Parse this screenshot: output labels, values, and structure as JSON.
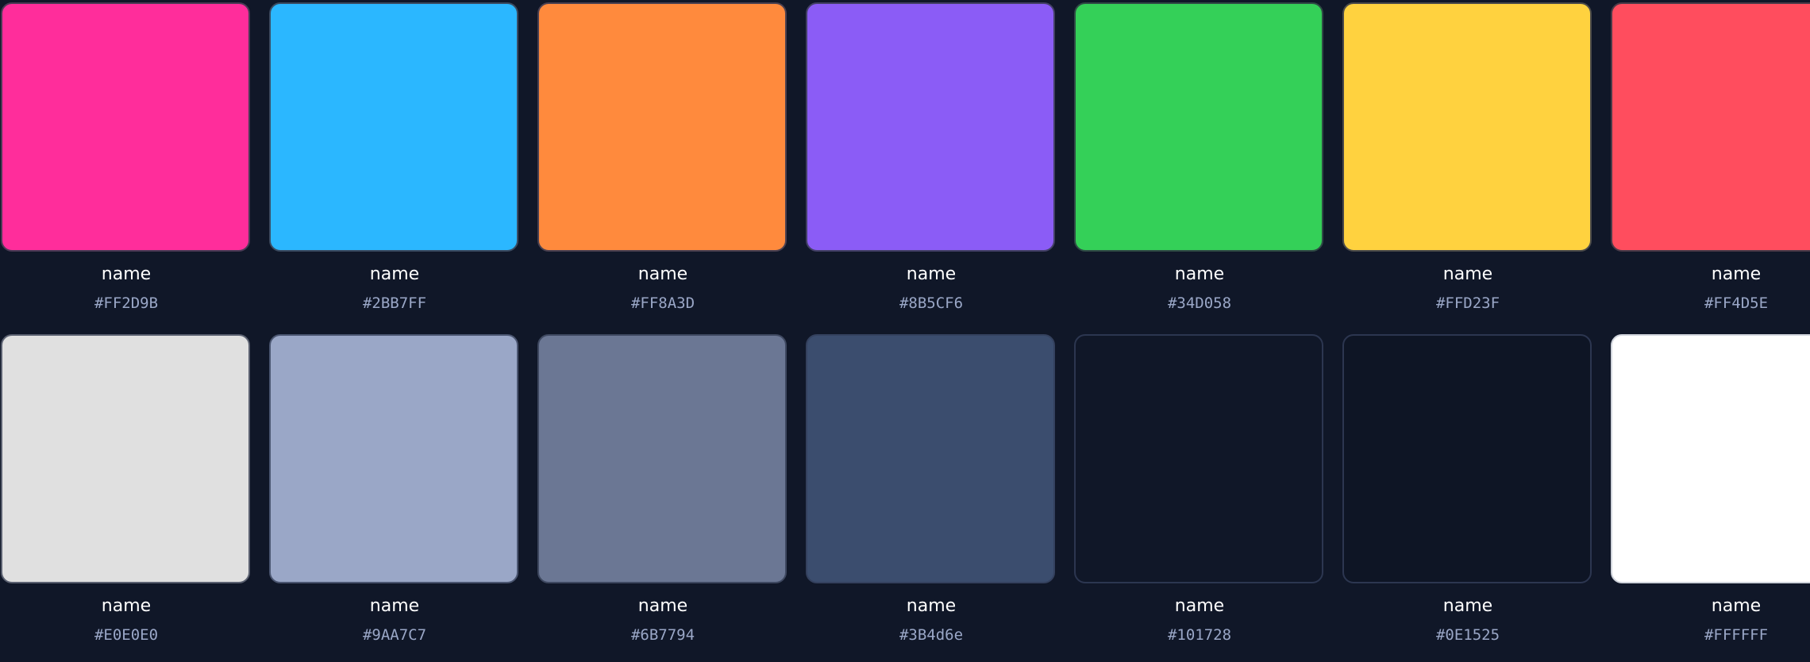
{
  "swatches": [
    {
      "name": "name",
      "hex": "#FF2D9B",
      "color": "#FF2D9B",
      "border": "#4a3a55"
    },
    {
      "name": "name",
      "hex": "#2BB7FF",
      "color": "#2BB7FF",
      "border": "#3a4a60"
    },
    {
      "name": "name",
      "hex": "#FF8A3D",
      "color": "#FF8A3D",
      "border": "#4a4050"
    },
    {
      "name": "name",
      "hex": "#8B5CF6",
      "color": "#8B5CF6",
      "border": "#434066"
    },
    {
      "name": "name",
      "hex": "#34D058",
      "color": "#34D058",
      "border": "#2f4a45"
    },
    {
      "name": "name",
      "hex": "#FFD23F",
      "color": "#FFD23F",
      "border": "#4a4a4a"
    },
    {
      "name": "name",
      "hex": "#FF4D5E",
      "color": "#FF4D5E",
      "border": "#4a3a48"
    },
    {
      "name": "name",
      "hex": "#E0E0E0",
      "color": "#E0E0E0",
      "border": "#5a6070"
    },
    {
      "name": "name",
      "hex": "#9AA7C7",
      "color": "#9AA7C7",
      "border": "#4a5570"
    },
    {
      "name": "name",
      "hex": "#6B7794",
      "color": "#6B7794",
      "border": "#3e4860"
    },
    {
      "name": "name",
      "hex": "#3B4d6e",
      "color": "#3B4d6e",
      "border": "#34415e"
    },
    {
      "name": "name",
      "hex": "#101728",
      "color": "#101728",
      "border": "#2c3650"
    },
    {
      "name": "name",
      "hex": "#0E1525",
      "color": "#0E1525",
      "border": "#2c3650"
    },
    {
      "name": "name",
      "hex": "#FFFFFF",
      "color": "#FFFFFF",
      "border": "#d0d4dc"
    }
  ]
}
